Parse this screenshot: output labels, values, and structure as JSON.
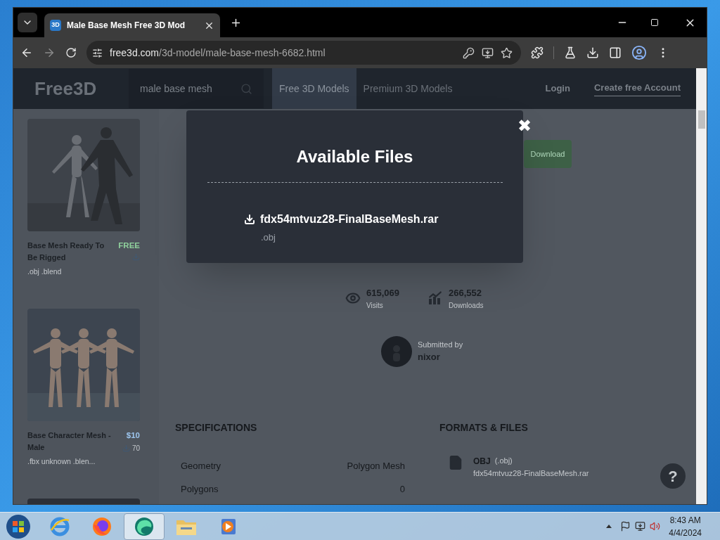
{
  "browser": {
    "tab": {
      "favicon": "3D",
      "title": "Male Base Mesh Free 3D Mod"
    },
    "address_host": "free3d.com",
    "address_path": "/3d-model/male-base-mesh-6682.html"
  },
  "site": {
    "logo": "Free3D",
    "search": "male base mesh",
    "nav": [
      {
        "label": "Free 3D Models",
        "selected": true
      },
      {
        "label": "Premium 3D Models",
        "selected": false
      }
    ],
    "login": "Login",
    "signup": "Create free Account"
  },
  "sidebar": [
    {
      "title": "Base Mesh Ready To Be Rigged",
      "price": "FREE",
      "kind": "free",
      "formats": ".obj .blend"
    },
    {
      "title": "Base Character Mesh - Male",
      "price": "$10",
      "kind": "paid",
      "count": "70",
      "formats": ".fbx unknown .blen..."
    }
  ],
  "download_button": "Download",
  "stats": [
    {
      "kind": "views",
      "value": "615,069",
      "label": "Visits"
    },
    {
      "kind": "downloads",
      "value": "266,552",
      "label": "Downloads"
    }
  ],
  "submitter": {
    "caption": "Submitted by",
    "name": "nixor"
  },
  "specifications": {
    "title": "SPECIFICATIONS",
    "rows": [
      {
        "label": "Geometry",
        "value": "Polygon Mesh"
      },
      {
        "label": "Polygons",
        "value": "0"
      }
    ]
  },
  "formats": {
    "title": "FORMATS & FILES",
    "files": [
      {
        "format": "OBJ",
        "ext": "(.obj)",
        "file": "fdx54mtvuz28-FinalBaseMesh.rar"
      }
    ]
  },
  "help": "?",
  "modal": {
    "title": "Available Files",
    "close": "✖",
    "files": [
      {
        "name": "fdx54mtvuz28-FinalBaseMesh.rar",
        "ext": ".obj"
      }
    ]
  },
  "taskbar": {
    "apps": [
      {
        "kind": "ie",
        "selected": false
      },
      {
        "kind": "firefox",
        "selected": false
      },
      {
        "kind": "edge",
        "selected": true
      },
      {
        "kind": "folder",
        "selected": false
      },
      {
        "kind": "media",
        "selected": false
      }
    ],
    "time": "8:43 AM",
    "date": "4/4/2024"
  }
}
